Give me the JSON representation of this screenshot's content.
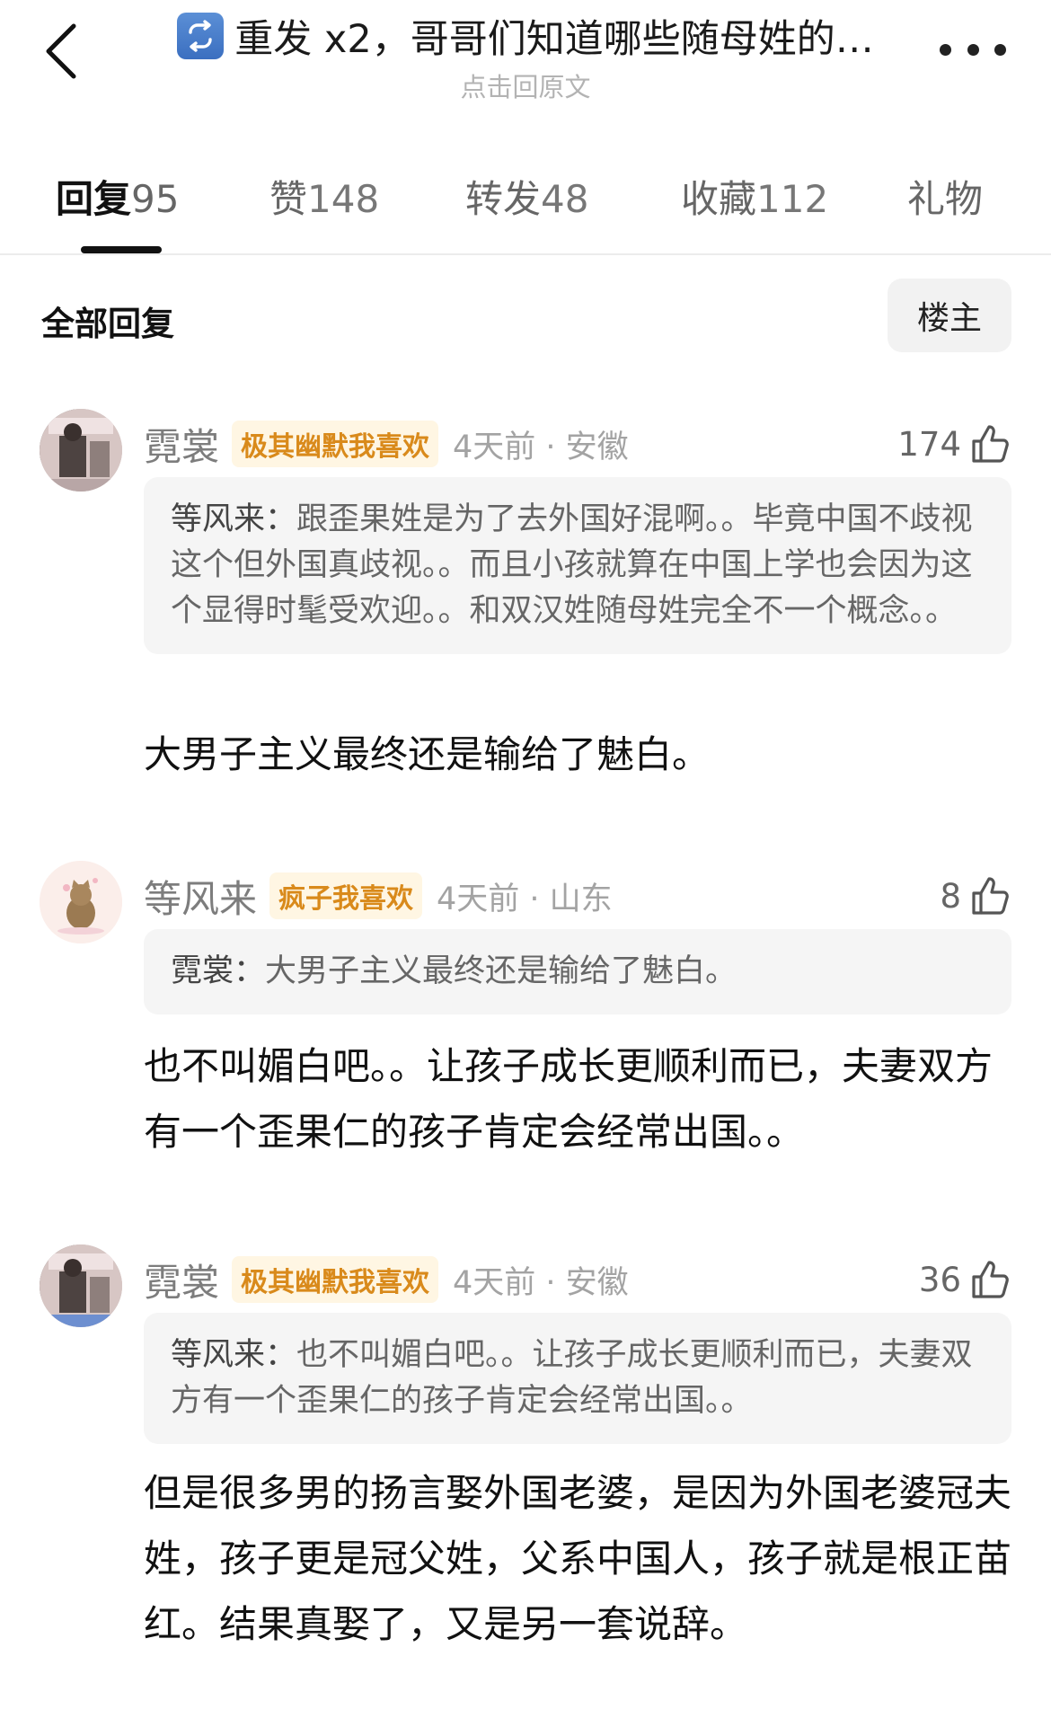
{
  "header": {
    "title": "重发 x2，哥哥们知道哪些随母姓的…",
    "subtitle": "点击回原文"
  },
  "tabs": [
    {
      "label": "回复",
      "count": "95"
    },
    {
      "label": "赞",
      "count": "148"
    },
    {
      "label": "转发",
      "count": "48"
    },
    {
      "label": "收藏",
      "count": "112"
    },
    {
      "label": "礼物",
      "count": ""
    }
  ],
  "filter": {
    "label": "全部回复",
    "owner_button": "楼主"
  },
  "comments": [
    {
      "username": "霓裳",
      "badge": "极其幽默我喜欢",
      "meta": "4天前 · 安徽",
      "likes": "174",
      "quote_author": "等风来：",
      "quote_text": "跟歪果姓是为了去外国好混啊。。毕竟中国不歧视这个但外国真歧视。。而且小孩就算在中国上学也会因为这个显得时髦受欢迎。。和双汉姓随母姓完全不一个概念。。",
      "text": "大男子主义最终还是输给了魅白。"
    },
    {
      "username": "等风来",
      "badge": "疯子我喜欢",
      "meta": "4天前 · 山东",
      "likes": "8",
      "quote_author": "霓裳：",
      "quote_text": "大男子主义最终还是输给了魅白。",
      "text": "也不叫媚白吧。。让孩子成长更顺利而已，夫妻双方有一个歪果仁的孩子肯定会经常出国。。"
    },
    {
      "username": "霓裳",
      "badge": "极其幽默我喜欢",
      "meta": "4天前 · 安徽",
      "likes": "36",
      "quote_author": "等风来：",
      "quote_text": "也不叫媚白吧。。让孩子成长更顺利而已，夫妻双方有一个歪果仁的孩子肯定会经常出国。。",
      "text": "但是很多男的扬言娶外国老婆，是因为外国老婆冠夫姓，孩子更是冠父姓，父系中国人，孩子就是根正苗红。结果真娶了，又是另一套说辞。"
    }
  ],
  "colors": {
    "badge_text": "#d98a1b",
    "badge_bg": "#fff6e3",
    "quote_bg": "#f5f5f5"
  },
  "icons": [
    "back-chevron-icon",
    "repost-icon",
    "more-dots-icon",
    "thumbs-up-icon"
  ]
}
